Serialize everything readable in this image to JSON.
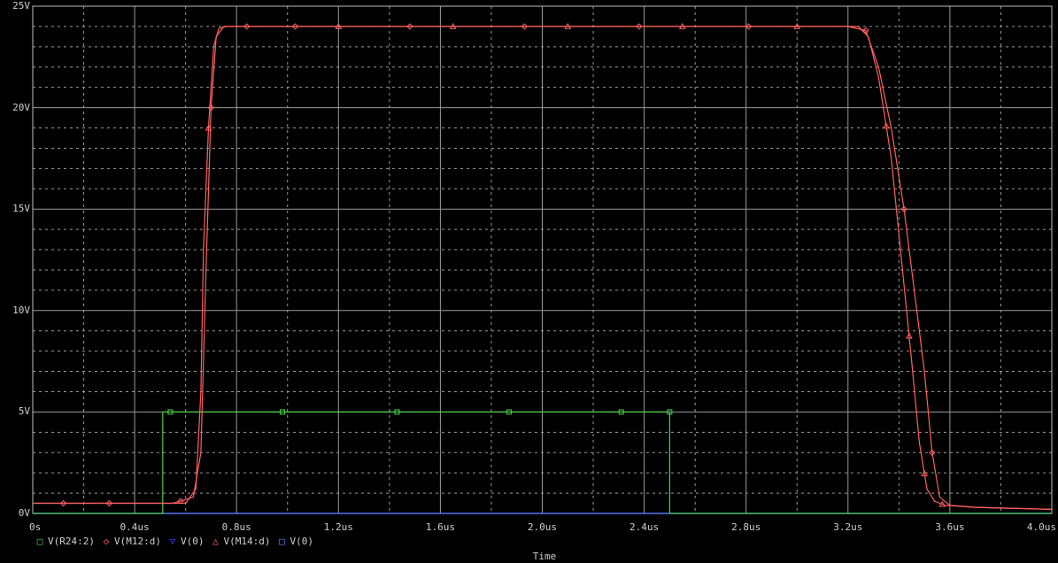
{
  "chart_data": {
    "type": "line",
    "xlabel": "Time",
    "ylabel": "",
    "xlim": [
      0,
      4.0
    ],
    "ylim": [
      0,
      25
    ],
    "grid": true,
    "legend_position": "bottom-left",
    "x_ticks": [
      "0s",
      "0.4us",
      "0.8us",
      "1.2us",
      "1.6us",
      "2.0us",
      "2.4us",
      "2.8us",
      "3.2us",
      "3.6us",
      "4.0us"
    ],
    "y_ticks": [
      "0V",
      "5V",
      "10V",
      "15V",
      "20V",
      "25V"
    ],
    "series": [
      {
        "name": "V(R24:2)",
        "color": "#4cd04c",
        "marker": "square",
        "x": [
          0,
          0.51,
          0.51,
          2.5,
          2.5,
          4.0
        ],
        "y": [
          0,
          0,
          5,
          5,
          0,
          0
        ],
        "marker_x": [
          0.54,
          0.98,
          1.43,
          1.87,
          2.31,
          2.5
        ]
      },
      {
        "name": "V(M12:d)",
        "color": "#ff6060",
        "marker": "diamond",
        "x": [
          0,
          0.55,
          0.63,
          0.66,
          0.68,
          0.7,
          0.72,
          0.75,
          0.78,
          3.2,
          3.27,
          3.32,
          3.37,
          3.42,
          3.47,
          3.5,
          3.53,
          3.56,
          3.6,
          3.7,
          4.0
        ],
        "y": [
          0.5,
          0.5,
          0.8,
          3,
          12,
          20,
          23.5,
          24,
          24,
          24,
          23.8,
          22,
          19,
          15,
          10,
          7,
          3,
          0.8,
          0.4,
          0.3,
          0.2
        ],
        "marker_x": [
          0.12,
          0.3,
          0.58,
          0.7,
          0.84,
          1.03,
          1.48,
          1.93,
          2.38,
          2.81,
          3.27,
          3.42,
          3.53
        ]
      },
      {
        "name": "V(0)",
        "color": "#4040ff",
        "marker": "triangle-down",
        "x": [
          0,
          4.0
        ],
        "y": [
          0,
          0
        ],
        "marker_x": []
      },
      {
        "name": "V(M14:d)",
        "color": "#ff6060",
        "marker": "triangle",
        "x": [
          0,
          0.6,
          0.64,
          0.66,
          0.67,
          0.69,
          0.71,
          0.73,
          0.76,
          3.24,
          3.28,
          3.32,
          3.37,
          3.41,
          3.45,
          3.48,
          3.51,
          3.54,
          3.58,
          3.7,
          4.0
        ],
        "y": [
          0.5,
          0.5,
          1.2,
          6,
          13,
          19,
          23,
          23.9,
          24,
          24,
          23.5,
          21.5,
          17.5,
          12.5,
          7.5,
          3.5,
          1.2,
          0.6,
          0.4,
          0.3,
          0.2
        ],
        "marker_x": [
          0.69,
          1.2,
          1.65,
          2.1,
          2.55,
          3.0,
          3.35,
          3.44,
          3.5,
          3.57
        ]
      },
      {
        "name": "V(0)",
        "color": "#6080ff",
        "marker": "square",
        "x": [
          0,
          4.0
        ],
        "y": [
          0,
          0
        ],
        "marker_x": []
      }
    ]
  }
}
